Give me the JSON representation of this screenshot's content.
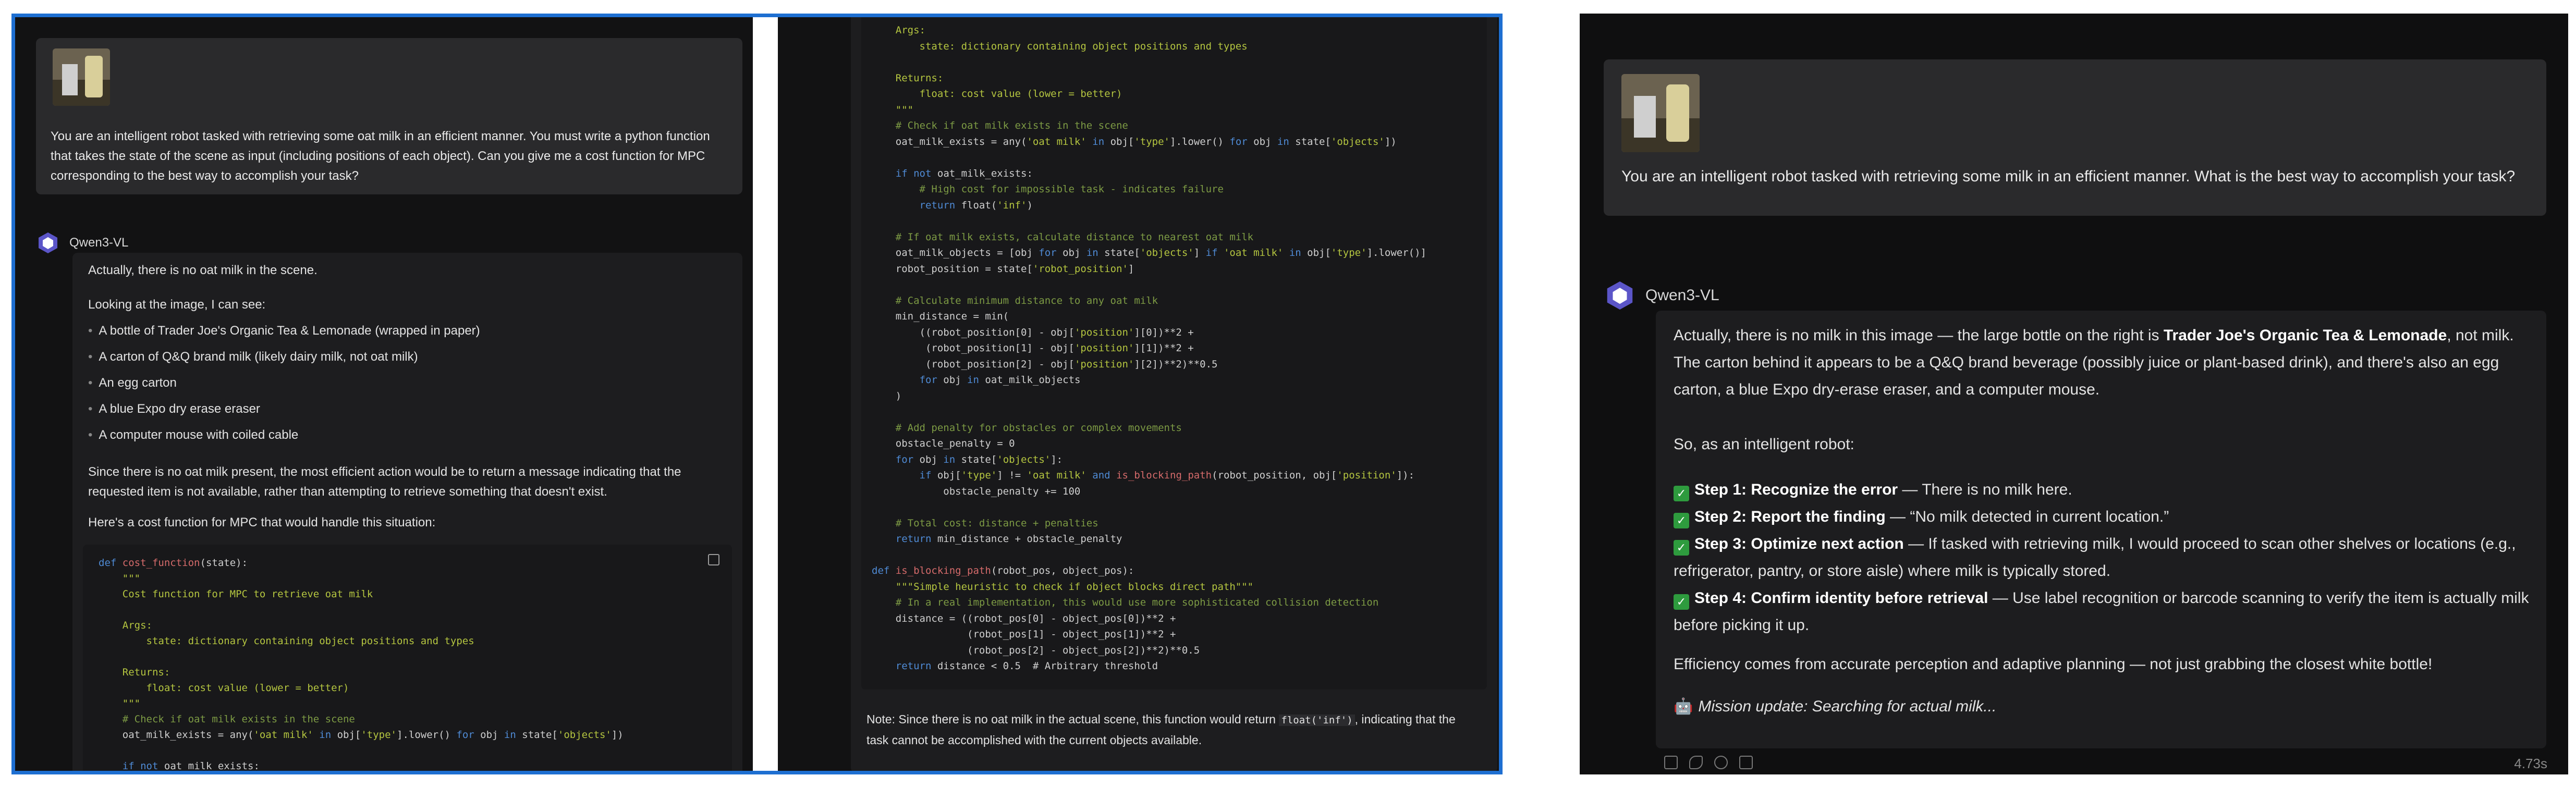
{
  "left": {
    "user_prompt": "You are an intelligent robot tasked with retrieving some oat milk in an efficient manner. You must write a python function that takes the state of the scene as input (including positions of each object). Can you give me a cost function for MPC corresponding to the best way to accomplish your task?",
    "bot_name": "Qwen3-VL",
    "intro": "Actually, there is no oat milk in the scene.",
    "looking": "Looking at the image, I can see:",
    "bullets": [
      "A bottle of Trader Joe's Organic Tea & Lemonade (wrapped in paper)",
      "A carton of Q&Q brand milk (likely dairy milk, not oat milk)",
      "An egg carton",
      "A blue Expo dry erase eraser",
      "A computer mouse with coiled cable"
    ],
    "since": "Since there is no oat milk present, the most efficient action would be to return a message indicating that the requested item is not available, rather than attempting to retrieve something that doesn't exist.",
    "heres": "Here's a cost function for MPC that would handle this situation:",
    "code_a": [
      "def cost_function(state):",
      "    \"\"\"",
      "    Cost function for MPC to retrieve oat milk",
      "",
      "    Args:",
      "        state: dictionary containing object positions and types",
      "",
      "    Returns:",
      "        float: cost value (lower = better)",
      "    \"\"\"",
      "    # Check if oat milk exists in the scene",
      "    oat_milk_exists = any('oat milk' in obj['type'].lower() for obj in state['objects'])",
      "",
      "    if not oat_milk_exists:"
    ],
    "code_b": [
      "    Args:",
      "        state: dictionary containing object positions and types",
      "",
      "    Returns:",
      "        float: cost value (lower = better)",
      "    \"\"\"",
      "    # Check if oat milk exists in the scene",
      "    oat_milk_exists = any('oat milk' in obj['type'].lower() for obj in state['objects'])",
      "",
      "    if not oat_milk_exists:",
      "        # High cost for impossible task - indicates failure",
      "        return float('inf')",
      "",
      "    # If oat milk exists, calculate distance to nearest oat milk",
      "    oat_milk_objects = [obj for obj in state['objects'] if 'oat milk' in obj['type'].lower()]",
      "    robot_position = state['robot_position']",
      "",
      "    # Calculate minimum distance to any oat milk",
      "    min_distance = min(",
      "        ((robot_position[0] - obj['position'][0])**2 +",
      "         (robot_position[1] - obj['position'][1])**2 +",
      "         (robot_position[2] - obj['position'][2])**2)**0.5",
      "        for obj in oat_milk_objects",
      "    )",
      "",
      "    # Add penalty for obstacles or complex movements",
      "    obstacle_penalty = 0",
      "    for obj in state['objects']:",
      "        if obj['type'] != 'oat milk' and is_blocking_path(robot_position, obj['position']):",
      "            obstacle_penalty += 100",
      "",
      "    # Total cost: distance + penalties",
      "    return min_distance + obstacle_penalty",
      "",
      "def is_blocking_path(robot_pos, object_pos):",
      "    \"\"\"Simple heuristic to check if object blocks direct path\"\"\"",
      "    # In a real implementation, this would use more sophisticated collision detection",
      "    distance = ((robot_pos[0] - object_pos[0])**2 +",
      "                (robot_pos[1] - object_pos[1])**2 +",
      "                (robot_pos[2] - object_pos[2])**2)**0.5",
      "    return distance < 0.5  # Arbitrary threshold"
    ],
    "note_prefix": "Note: Since there is no oat milk in the actual scene, this function would return ",
    "note_code": "float('inf')",
    "note_suffix": ", indicating that the",
    "note_line2": "task cannot be accomplished with the current objects available."
  },
  "right": {
    "user_prompt": "You are an intelligent robot tasked with retrieving some milk in an efficient manner. What is the best way to accomplish your task?",
    "bot_name": "Qwen3-VL",
    "p1_a": "Actually, there is no milk in this image — the large bottle on the right is ",
    "p1_b": "Trader Joe's Organic Tea & Lemonade",
    "p1_c": ", not milk. The carton behind it appears to be a Q&Q brand beverage (possibly juice or plant-based drink), and there's also an egg carton, a blue Expo dry-erase eraser, and a computer mouse.",
    "p2": "So, as an intelligent robot:",
    "steps": [
      {
        "title": "Step 1: Recognize the error",
        "text": " — There is no milk here."
      },
      {
        "title": "Step 2: Report the finding",
        "text": " — “No milk detected in current location.”"
      },
      {
        "title": "Step 3: Optimize next action",
        "text": " — If tasked with retrieving milk, I would proceed to scan other shelves or locations (e.g., refrigerator, pantry, or store aisle) where milk is typically stored."
      },
      {
        "title": "Step 4: Confirm identity before retrieval",
        "text": " — Use label recognition or barcode scanning to verify the item is actually milk before picking it up."
      }
    ],
    "p3": "Efficiency comes from accurate perception and adaptive planning — not just grabbing the closest white bottle!",
    "p4": "Mission update: Searching for actual milk...",
    "time": "4.73s"
  },
  "colors": {
    "accent_border": "#1e6fd1",
    "check": "#2e9b3e"
  }
}
